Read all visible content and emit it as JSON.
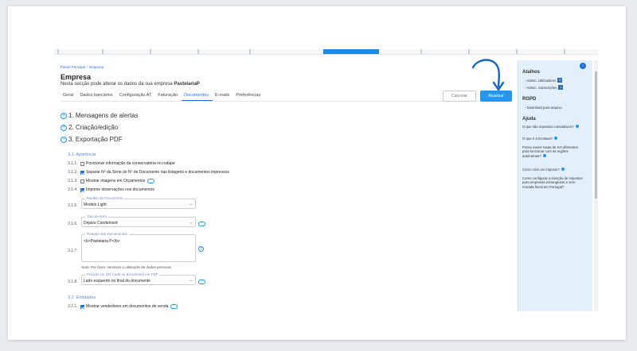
{
  "breadcrumb": {
    "root": "Painel Principal",
    "sep": "/",
    "current": "Empresa"
  },
  "page": {
    "title": "Empresa",
    "subtitle_prefix": "Nesta secção pode alterar os dados da sua empresa ",
    "company": "PastelariaP"
  },
  "tabs": [
    "Geral",
    "Dados bancários",
    "Configuração AT",
    "Faturação",
    "Documentos",
    "E-mails",
    "Preferências"
  ],
  "active_tab": "Documentos",
  "buttons": {
    "cancel": "Cancelar",
    "update": "Atualizar"
  },
  "sections": {
    "alerts": "1. Mensagens de alertas",
    "creation": "2. Criação/edição",
    "export": "3. Exportação PDF"
  },
  "export": {
    "appearance": "3.1. Aparência",
    "rows": [
      {
        "num": "3.1.1.",
        "label": "Posicionar informação da conservatória no rodapé",
        "checked": false
      },
      {
        "num": "3.1.2.",
        "label": "Separar Nº da Série do Nº de Documento nas listagens e documentos impressos",
        "checked": true
      },
      {
        "num": "3.1.3.",
        "label": "Mostrar imagens em Orçamentos",
        "checked": false
      },
      {
        "num": "3.1.4.",
        "label": "Imprime observações nos documentos",
        "checked": true
      }
    ],
    "model": {
      "num": "3.1.5.",
      "label": "Modelo de Documento",
      "value": "Modelo Light"
    },
    "font": {
      "num": "3.1.6.",
      "label": "Tipo de letra",
      "value": "Dejavu Condensed"
    },
    "footer": {
      "num": "3.1.7.",
      "label": "Rodapé dos Documentos",
      "value": "<b>Pastelaria P</b>"
    },
    "note_prefix": "Nota:",
    "note_text": " Por favor, minimize a utilização de dados pessoais.",
    "qr": {
      "num": "3.1.8.",
      "label": "Posição do QR Code no documento em PDF",
      "value": "Lado esquerdo no final do documento"
    },
    "entities": "3.2. Entidades",
    "entity_row": {
      "num": "3.2.1.",
      "label": "Mostrar vendedores em documentos de venda",
      "checked": true
    }
  },
  "sidebar": {
    "shortcuts_title": "Atalhos",
    "shortcuts": [
      {
        "label": "- Admin. Utilizadores",
        "badge": "6"
      },
      {
        "label": "- Admin. Subscrições",
        "badge": "1"
      }
    ],
    "rgpd_title": "RGPD",
    "rgpd_link": "- Download para arquivo",
    "help_title": "Ajuda",
    "help": [
      "O que são impostos cumulativos?",
      "O que é a Ecotaxa?",
      "Posso inserir taxas de IVA diferentes para funcionar com as regiões autónomas?",
      "Como criar um imposto?",
      "Como configurar a isenção de impostos para empresas estrangeiras e sem morada fiscal em Portugal?"
    ]
  },
  "colors": {
    "accent": "#1e6fd9",
    "button": "#2196f3",
    "sidebar_bg": "#e3effb"
  }
}
